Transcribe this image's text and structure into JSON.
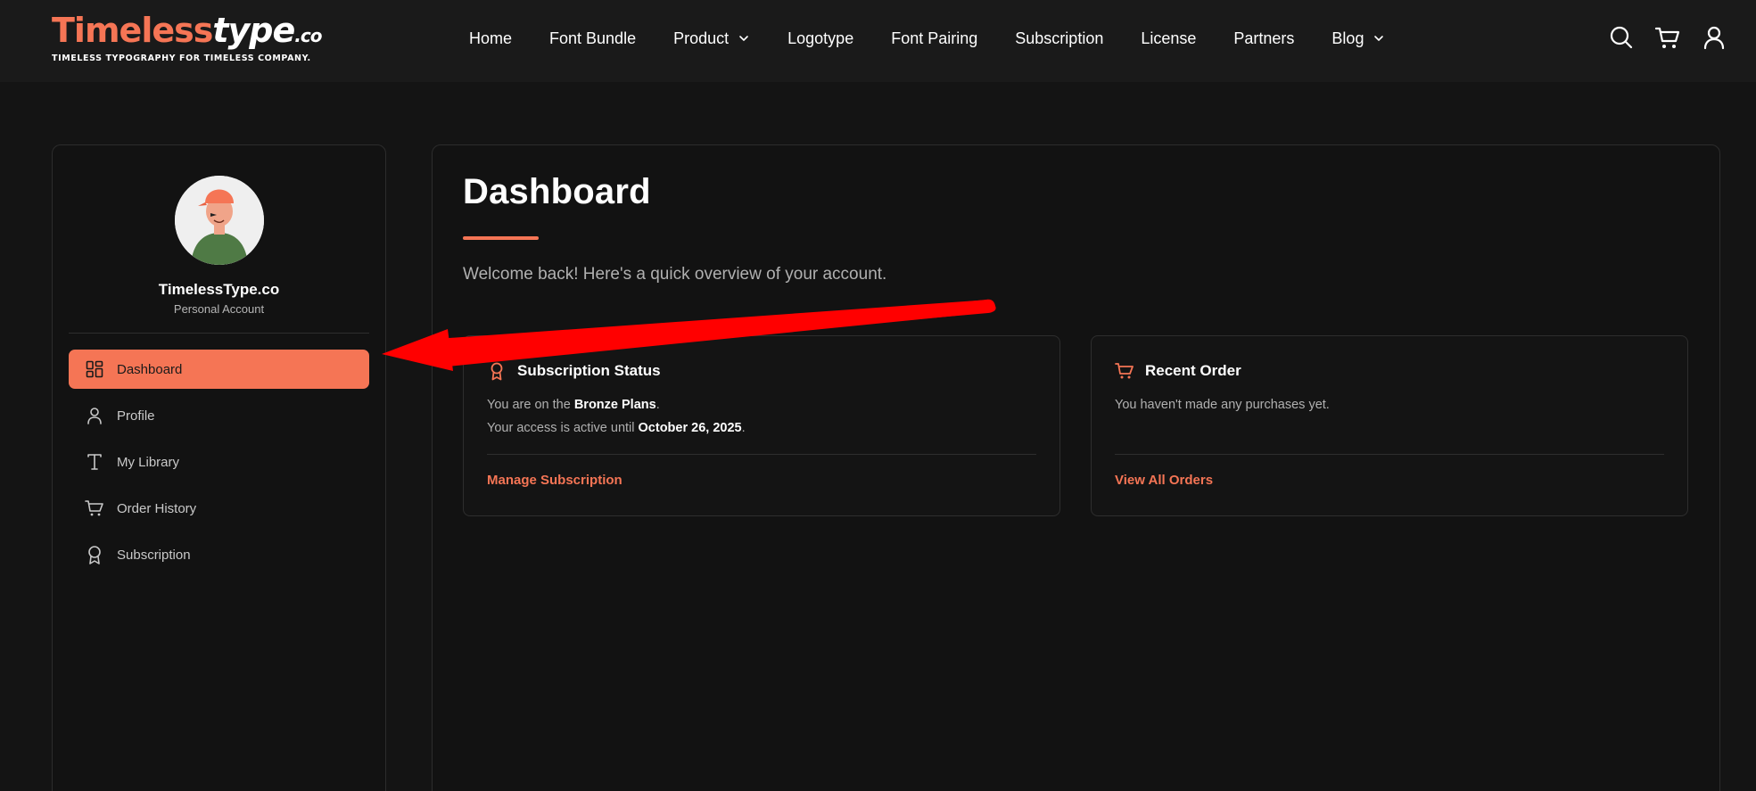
{
  "brand": {
    "logo_part1": "Timeless",
    "logo_part2": "type",
    "logo_part3": ".co",
    "tagline": "TIMELESS TYPOGRAPHY FOR TIMELESS COMPANY.",
    "accent_color": "#f57555"
  },
  "nav": {
    "items": [
      {
        "label": "Home"
      },
      {
        "label": "Font Bundle"
      },
      {
        "label": "Product",
        "dropdown": true
      },
      {
        "label": "Logotype"
      },
      {
        "label": "Font Pairing"
      },
      {
        "label": "Subscription"
      },
      {
        "label": "License"
      },
      {
        "label": "Partners"
      },
      {
        "label": "Blog",
        "dropdown": true
      }
    ],
    "icons": [
      "search-icon",
      "cart-icon",
      "user-icon"
    ]
  },
  "sidebar": {
    "account_name": "TimelessType.co",
    "account_type": "Personal Account",
    "items": [
      {
        "label": "Dashboard",
        "icon": "dashboard-icon",
        "active": true
      },
      {
        "label": "Profile",
        "icon": "user-icon"
      },
      {
        "label": "My Library",
        "icon": "text-icon"
      },
      {
        "label": "Order History",
        "icon": "cart-icon"
      },
      {
        "label": "Subscription",
        "icon": "award-icon"
      }
    ]
  },
  "main": {
    "title": "Dashboard",
    "welcome": "Welcome back! Here's a quick overview of your account.",
    "subscription_card": {
      "title": "Subscription Status",
      "line1_prefix": "You are on the ",
      "plan": "Bronze Plans",
      "line1_suffix": ".",
      "line2_prefix": "Your access is active until ",
      "date": "October 26, 2025",
      "line2_suffix": ".",
      "link": "Manage Subscription"
    },
    "order_card": {
      "title": "Recent Order",
      "message": "You haven't made any purchases yet.",
      "link": "View All Orders"
    }
  }
}
